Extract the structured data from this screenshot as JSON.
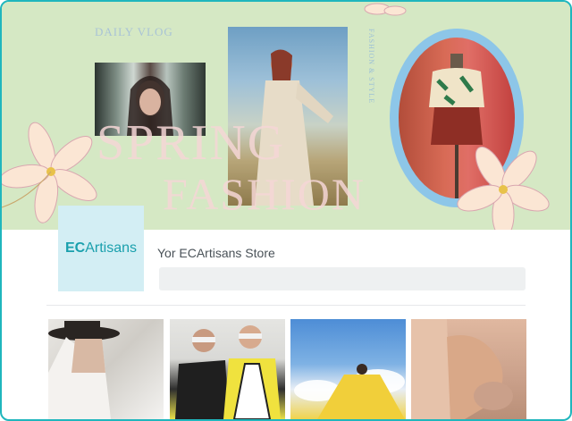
{
  "banner": {
    "tagline": "DAILY VLOG",
    "side_text": "FASHION & STYLE",
    "headline_line1": "SPRING",
    "headline_line2": "FASHION"
  },
  "store": {
    "logo_prefix": "EC",
    "logo_suffix": "Artisans",
    "title": "Yor ECArtisans Store",
    "search_value": ""
  },
  "colors": {
    "border": "#1fb6bd",
    "banner_bg": "#d5e8c4",
    "logo_bg": "#d3eef4",
    "logo_text": "#1aa0ad"
  },
  "gallery": [
    {
      "name": "gallery-photo-woman-hat"
    },
    {
      "name": "gallery-photo-two-models-sunglasses"
    },
    {
      "name": "gallery-photo-yellow-dress-sky"
    },
    {
      "name": "gallery-photo-peach-sleeve"
    }
  ]
}
